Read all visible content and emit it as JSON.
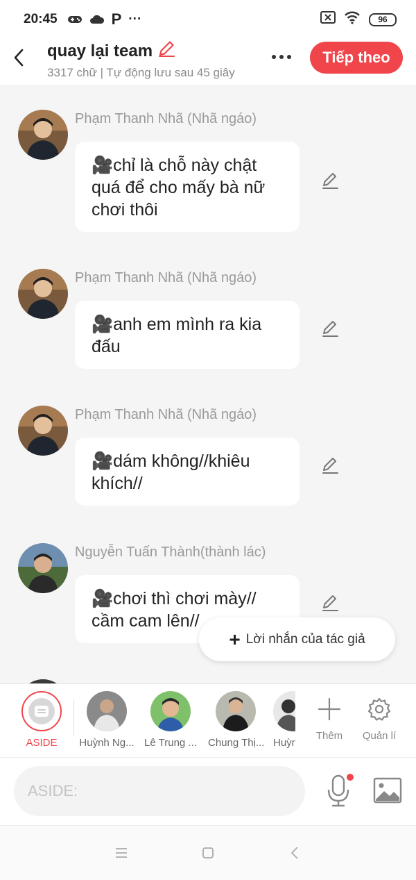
{
  "status_bar": {
    "time": "20:45",
    "app_icon_letter": "P",
    "overflow": "···",
    "battery": "96"
  },
  "header": {
    "title": "quay lại team",
    "subtitle": "3317 chữ | Tự động lưu sau 45 giây",
    "next_label": "Tiếp theo"
  },
  "messages": [
    {
      "name": "Phạm Thanh Nhã (Nhã ngáo)",
      "text": "🎥chỉ là chỗ này chật quá để cho mấy bà nữ chơi thôi"
    },
    {
      "name": "Phạm Thanh Nhã (Nhã ngáo)",
      "text": "🎥anh em mình ra kia đấu"
    },
    {
      "name": "Phạm Thanh Nhã (Nhã ngáo)",
      "text": "🎥dám không//khiêu khích//"
    },
    {
      "name": "Nguyễn Tuấn Thành(thành lác)",
      "text": "🎥chơi thì chơi mày// cầm cam lên//"
    }
  ],
  "author_note": {
    "label": "Lời nhắn của tác giả"
  },
  "characters": [
    {
      "label": "ASIDE"
    },
    {
      "label": "Huỳnh Ng..."
    },
    {
      "label": "Lê Trung ..."
    },
    {
      "label": "Chung Thị..."
    },
    {
      "label": "Huỳn"
    }
  ],
  "tools": {
    "add_label": "Thêm",
    "manage_label": "Quản lí"
  },
  "composer": {
    "placeholder": "ASIDE:"
  },
  "colors": {
    "accent": "#f0454b",
    "background": "#f5f5f5"
  }
}
